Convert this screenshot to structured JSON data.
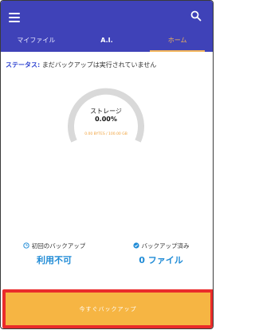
{
  "header": {
    "tabs": [
      {
        "label": "マイファイル"
      },
      {
        "label": "A.I."
      },
      {
        "label": "ホーム"
      }
    ],
    "icons": {
      "menu": "hamburger-menu-icon",
      "search": "search-icon"
    },
    "colors": {
      "primary": "#3f42b8",
      "accent": "#f3b55a"
    }
  },
  "status": {
    "label": "ステータス:",
    "text": "まだバックアップは実行されていません"
  },
  "storage": {
    "title": "ストレージ",
    "percent_text": "0.00%",
    "usage_text": "0.00 BYTES / 100.00 GB",
    "used_fraction": 0.0
  },
  "stats": {
    "first_backup": {
      "label": "初回のバックアップ",
      "value": "利用不可",
      "icon": "clock-icon"
    },
    "backed_up": {
      "label": "バックアップ済み",
      "value": "0 ファイル",
      "icon": "check-circle-icon"
    }
  },
  "action": {
    "backup_now_label": "今すぐバックアップ",
    "color": "#f6b543",
    "highlight_color": "#ea2b2b"
  }
}
